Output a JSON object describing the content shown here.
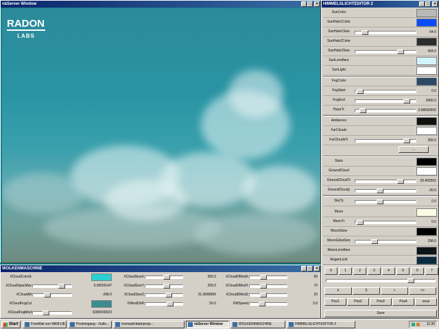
{
  "render_window": {
    "title": "näServer Window"
  },
  "logo": {
    "main": "RADON",
    "sub": "LABS"
  },
  "editor": {
    "title": "HIMMELSLICHTEDITOR 2",
    "rows": [
      {
        "label": "SunColor",
        "kind": "color",
        "color": "#b8b8b8"
      },
      {
        "label": "SunHalo1Color",
        "kind": "color",
        "color": "#0a4cf8"
      },
      {
        "label": "SunHalo1Size",
        "kind": "slider",
        "fill": 0.12,
        "value": "64.0"
      },
      {
        "label": "SunHalo2Color",
        "kind": "color",
        "color": "#2c2c2c"
      },
      {
        "label": "SunHalo2Size",
        "kind": "slider",
        "fill": 0.78,
        "value": "434.0"
      },
      {
        "label": "SunLensflare",
        "kind": "color",
        "color": "#d4f4fc"
      },
      {
        "label": "SunLight",
        "kind": "color",
        "color": "#ffffff"
      },
      {
        "label": "FogColor",
        "kind": "color",
        "color": "#2c4a66"
      },
      {
        "label": "FogStart",
        "kind": "slider",
        "fill": 0.02,
        "value": "0.0"
      },
      {
        "label": "FogEnd",
        "kind": "slider",
        "fill": 0.9,
        "value": "2000.0"
      },
      {
        "label": "HazeTr",
        "kind": "slider",
        "fill": 0.08,
        "value": "0.99992692"
      },
      {
        "label": "Ambience",
        "kind": "color",
        "color": "#101010"
      },
      {
        "label": "FarClouds",
        "kind": "color",
        "color": "#ffffff"
      },
      {
        "label": "FarCloudsTr",
        "kind": "slider",
        "fill": 0.9,
        "value": "255.0"
      },
      {
        "label": "Stars",
        "kind": "color",
        "color": "#000000"
      },
      {
        "label": "GroundCloud",
        "kind": "color",
        "color": "#ffffff"
      },
      {
        "label": "GroundCloudTr",
        "kind": "slider",
        "fill": 0.78,
        "value": "29.455552"
      },
      {
        "label": "GroundCloudy",
        "kind": "slider",
        "fill": 0.4,
        "value": "-20.0"
      },
      {
        "label": "SkyTy",
        "kind": "slider",
        "fill": 0.4,
        "value": "0.0"
      },
      {
        "label": "Moon",
        "kind": "color",
        "color": "#fcfce4"
      },
      {
        "label": "MoonTr",
        "kind": "slider",
        "fill": 0.02,
        "value": "0.0"
      },
      {
        "label": "MoonGlow",
        "kind": "color",
        "color": "#000000"
      },
      {
        "label": "MoonGlowSize",
        "kind": "slider",
        "fill": 0.3,
        "value": "298.0"
      },
      {
        "label": "MoonLensflare",
        "kind": "color",
        "color": "#0c1418"
      },
      {
        "label": "RegenLicht",
        "kind": "color",
        "color": "#0a2a40"
      }
    ],
    "numbers": [
      "0",
      "1",
      "2",
      "3",
      "4",
      "5",
      "6",
      "7"
    ],
    "time_slider_fill": 0.8,
    "nav": [
      "k",
      "5",
      ">",
      ">>"
    ],
    "positions": [
      "Pos1",
      "Pos2",
      "Pos3",
      "Pos4",
      "zeus"
    ],
    "save_label": "Save",
    "farclouds_button": "..."
  },
  "wolken": {
    "title": "WOLKENMASCHINE",
    "col1": [
      {
        "label": "XCloudColorE",
        "kind": "color",
        "color": "#2ad0d0"
      },
      {
        "label": "XCloudOpacMax",
        "kind": "slider",
        "fill": 0.8,
        "value": "0.00000147"
      },
      {
        "label": "XCloudAlt",
        "kind": "slider",
        "fill": 0.35,
        "value": "-298.0"
      },
      {
        "label": "XCloudFogCol",
        "kind": "color",
        "color": "#3c8c90"
      },
      {
        "label": "XCloudFogMod",
        "kind": "slider",
        "fill": 0.3,
        "value": "6000000023"
      }
    ],
    "col2": [
      {
        "label": "XCloudSizeX",
        "kind": "slider",
        "fill": 0.6,
        "value": "350.0"
      },
      {
        "label": "XCloudSizeY",
        "kind": "slider",
        "fill": 0.6,
        "value": "200.0"
      },
      {
        "label": "XCloudSizeZ",
        "kind": "slider",
        "fill": 0.65,
        "value": "31.3689995"
      },
      {
        "label": "XWindDirR",
        "kind": "slider",
        "fill": 0.7,
        "value": "50.0"
      }
    ],
    "col3": [
      {
        "label": "XCloudDModX",
        "kind": "slider",
        "fill": 0.35,
        "value": "90"
      },
      {
        "label": "XCloudDModY",
        "kind": "slider",
        "fill": 0.35,
        "value": "70"
      },
      {
        "label": "XCloudDModZ",
        "kind": "slider",
        "fill": 0.35,
        "value": "20"
      },
      {
        "label": "XWSpeed",
        "kind": "slider",
        "fill": 0.3,
        "value": "3.0"
      }
    ]
  },
  "taskbar": {
    "start": "Start",
    "items": [
      {
        "label": "FreeMail von WEB.DE ...",
        "active": false
      },
      {
        "label": "Posteingang - Outlo...",
        "active": false
      },
      {
        "label": "\\nomads\\data\\proje...",
        "active": false
      },
      {
        "label": "näServer Window",
        "active": true
      },
      {
        "label": "WOLKENMASCHINE",
        "active": false
      },
      {
        "label": "HIMMELSLICHTEDITOR 2",
        "active": false
      }
    ],
    "clock": "11:30"
  }
}
